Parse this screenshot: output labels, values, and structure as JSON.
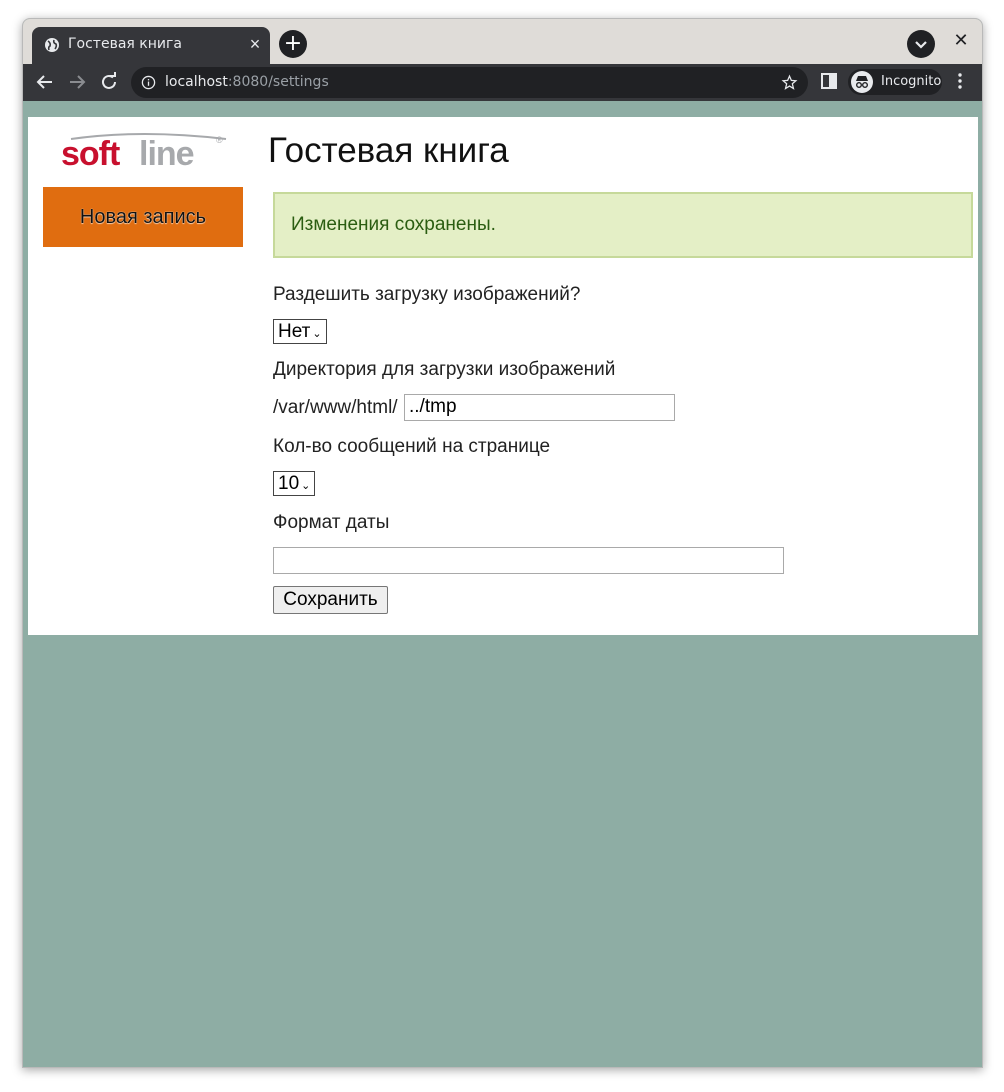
{
  "browser": {
    "tab_title": "Гостевая книга",
    "url_host": "localhost",
    "url_rest": ":8080/settings",
    "incognito_label": "Incognito"
  },
  "sidebar": {
    "logo_alt": "softline",
    "new_entry_label": "Новая запись"
  },
  "main": {
    "title": "Гостевая книга",
    "alert": "Изменения сохранены.",
    "allow_upload_label": "Раздешить загрузку изображений?",
    "allow_upload_value": "Нет",
    "upload_dir_label": "Директория для загрузки изображений",
    "upload_dir_prefix": "/var/www/html/",
    "upload_dir_value": "../tmp",
    "per_page_label": "Кол-во сообщений на странице",
    "per_page_value": "10",
    "date_format_label": "Формат даты",
    "date_format_value": "",
    "save_label": "Сохранить"
  },
  "colors": {
    "page_bg": "#8eada4",
    "accent_button": "#e06d10",
    "alert_bg": "#e4efc6",
    "logo_red": "#c8102e",
    "logo_gray": "#a7a9ac"
  }
}
